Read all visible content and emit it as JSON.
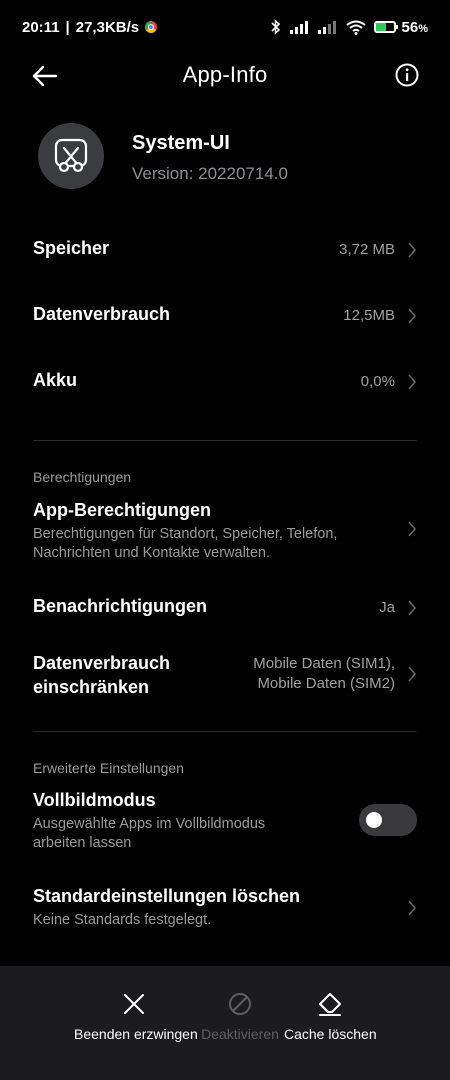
{
  "status_bar": {
    "time": "20:11",
    "separator": "|",
    "network_speed": "27,3KB/s",
    "battery_percent": "56",
    "battery_unit": "%",
    "icons": [
      "chrome-icon",
      "bluetooth-icon",
      "signal-icon",
      "signal-icon",
      "wifi-icon",
      "battery-charging-icon"
    ]
  },
  "header": {
    "title": "App-Info",
    "back_icon": "arrow-left-icon",
    "info_icon": "info-icon"
  },
  "app": {
    "name": "System-UI",
    "version": "Version: 20220714.0",
    "icon": "system-ui-icon"
  },
  "rows": {
    "storage": {
      "title": "Speicher",
      "value": "3,72 MB"
    },
    "data_usage": {
      "title": "Datenverbrauch",
      "value": "12,5MB"
    },
    "battery": {
      "title": "Akku",
      "value": "0,0%"
    }
  },
  "permissions_section": {
    "label": "Berechtigungen",
    "app_permissions": {
      "title": "App-Berechtigungen",
      "subtitle_line1": "Berechtigungen für Standort, Speicher, Telefon,",
      "subtitle_line2": "Nachrichten und Kontakte verwalten."
    },
    "notifications": {
      "title": "Benachrichtigungen",
      "value": "Ja"
    },
    "restrict_data": {
      "title_line1": "Datenverbrauch",
      "title_line2": "einschränken",
      "value_line1": "Mobile Daten (SIM1),",
      "value_line2": "Mobile Daten (SIM2)"
    }
  },
  "advanced_section": {
    "label": "Erweiterte Einstellungen",
    "fullscreen": {
      "title": "Vollbildmodus",
      "subtitle_line1": "Ausgewählte Apps im Vollbildmodus",
      "subtitle_line2": "arbeiten lassen",
      "enabled": false
    },
    "clear_defaults": {
      "title": "Standardeinstellungen löschen",
      "subtitle": "Keine Standards festgelegt."
    }
  },
  "bottom_actions": [
    {
      "label": "Beenden erzwingen",
      "icon": "close-icon",
      "enabled": true
    },
    {
      "label": "Deaktivieren",
      "icon": "disable-icon",
      "enabled": false
    },
    {
      "label": "Cache löschen",
      "icon": "eraser-icon",
      "enabled": true
    }
  ],
  "colors": {
    "background": "#000000",
    "bottom_bar": "#1c1c1e",
    "secondary_text": "#9a9a9a",
    "disabled_text": "#5e5e62",
    "toggle_off": "#3a3a3c",
    "battery_fill": "#34c759"
  }
}
